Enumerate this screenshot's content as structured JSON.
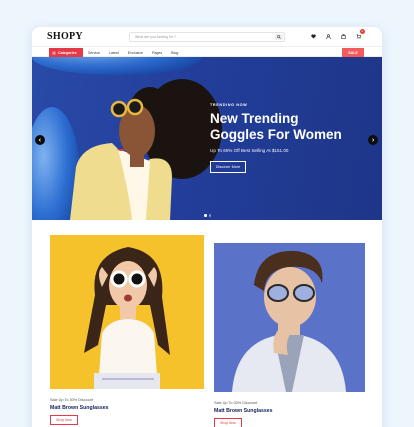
{
  "header": {
    "logo": "SHOPY",
    "search_placeholder": "What are you looking for ?",
    "cart_count": "0"
  },
  "nav": {
    "categories_label": "Categories",
    "links": [
      "Service",
      "Latest",
      "Exclusive",
      "Pages",
      "Blog"
    ],
    "sale_label": "SALE"
  },
  "hero": {
    "eyebrow": "TRENDING NOW",
    "headline_line1": "New Trending",
    "headline_line2": "Goggles For Women",
    "subline": "Up To 60% Off Best Selling At $151.00",
    "cta": "Discover More",
    "slide_count": 2,
    "active_slide": 1
  },
  "products": [
    {
      "caption": "Sale Up To 30% Discount",
      "name": "Matt Brown Sunglasses",
      "cta": "Shop Now"
    },
    {
      "caption": "Sale Up To 30% Discount",
      "name": "Matt Brown Sunglasses",
      "cta": "Shop Now"
    }
  ],
  "colors": {
    "background": "#eef6fd",
    "accent_red": "#e53945",
    "hero_blue": "#223e9a",
    "card1_bg": "#f6c22b",
    "card2_bg": "#5b72c9",
    "title_navy": "#16215a"
  },
  "icons": [
    "search-icon",
    "user-icon",
    "heart-icon",
    "bag-icon",
    "cart-icon",
    "menu-icon",
    "chevron-left-icon",
    "chevron-right-icon"
  ]
}
